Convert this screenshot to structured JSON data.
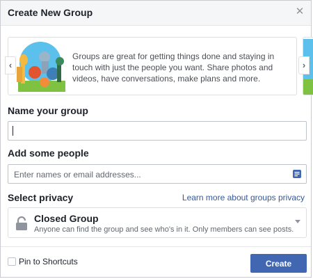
{
  "dialog": {
    "title": "Create New Group",
    "close_icon": "close-icon"
  },
  "carousel": {
    "description": "Groups are great for getting things done and staying in touch with just the people you want. Share photos and videos, have conversations, make plans and more.",
    "prev_icon": "chevron-left-icon",
    "next_icon": "chevron-right-icon"
  },
  "name_section": {
    "label": "Name your group",
    "value": ""
  },
  "people_section": {
    "label": "Add some people",
    "placeholder": "Enter names or email addresses...",
    "icon": "contact-list-icon"
  },
  "privacy_section": {
    "label": "Select privacy",
    "learn_more_link": "Learn more about groups privacy",
    "selected_option": {
      "title": "Closed Group",
      "description": "Anyone can find the group and see who's in it. Only members can see posts.",
      "icon": "lock-icon"
    }
  },
  "footer": {
    "pin_label": "Pin to Shortcuts",
    "pin_checked": false,
    "create_button": "Create"
  },
  "colors": {
    "primary": "#4267b2",
    "link": "#365899",
    "header_bg": "#f5f6f7"
  }
}
